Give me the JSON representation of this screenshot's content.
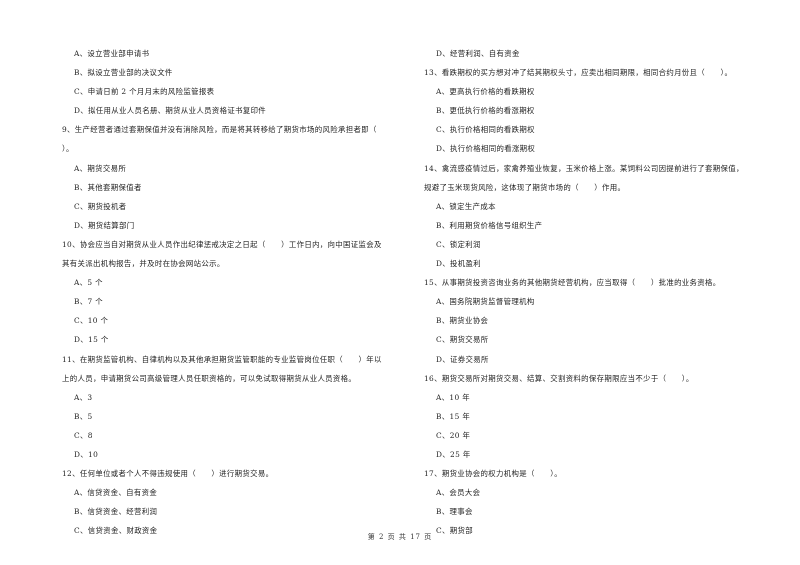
{
  "left_column": [
    {
      "type": "opt",
      "text": "A、设立营业部申请书"
    },
    {
      "type": "opt",
      "text": "B、拟设立营业部的决议文件"
    },
    {
      "type": "opt",
      "text": "C、申请日前 2 个月月末的风险监管报表"
    },
    {
      "type": "opt",
      "text": "D、拟任用从业人员名册、期货从业人员资格证书复印件"
    },
    {
      "type": "q",
      "text": "9、生产经营者通过套期保值并没有消除风险，而是将其转移给了期货市场的风险承担者即（"
    },
    {
      "type": "q",
      "text": "）。"
    },
    {
      "type": "opt",
      "text": "A、期货交易所"
    },
    {
      "type": "opt",
      "text": "B、其他套期保值者"
    },
    {
      "type": "opt",
      "text": "C、期货投机者"
    },
    {
      "type": "opt",
      "text": "D、期货结算部门"
    },
    {
      "type": "q",
      "text": "10、协会应当自对期货从业人员作出纪律惩戒决定之日起（　　）工作日内，向中国证监会及"
    },
    {
      "type": "q",
      "text": "其有关派出机构报告，并及时在协会网站公示。"
    },
    {
      "type": "opt",
      "text": "A、5 个"
    },
    {
      "type": "opt",
      "text": "B、7 个"
    },
    {
      "type": "opt",
      "text": "C、10 个"
    },
    {
      "type": "opt",
      "text": "D、15 个"
    },
    {
      "type": "q",
      "text": "11、在期货监管机构、自律机构以及其他承担期货监管职能的专业监管岗位任职（　　）年以"
    },
    {
      "type": "q",
      "text": "上的人员，申请期货公司高级管理人员任职资格的，可以免试取得期货从业人员资格。"
    },
    {
      "type": "opt",
      "text": "A、3"
    },
    {
      "type": "opt",
      "text": "B、5"
    },
    {
      "type": "opt",
      "text": "C、8"
    },
    {
      "type": "opt",
      "text": "D、10"
    },
    {
      "type": "q",
      "text": "12、任何单位或者个人不得违规使用（　　）进行期货交易。"
    },
    {
      "type": "opt",
      "text": "A、信贷资金、自有资金"
    },
    {
      "type": "opt",
      "text": "B、信贷资金、经营利润"
    },
    {
      "type": "opt",
      "text": "C、信贷资金、财政资金"
    }
  ],
  "right_column": [
    {
      "type": "opt",
      "text": "D、经营利润、自有资金"
    },
    {
      "type": "q",
      "text": "13、看跌期权的买方想对冲了结其期权头寸，应卖出相同期限，相同合约月份且（　　）。"
    },
    {
      "type": "opt",
      "text": "A、更高执行价格的看跌期权"
    },
    {
      "type": "opt",
      "text": "B、更低执行价格的看涨期权"
    },
    {
      "type": "opt",
      "text": "C、执行价格相同的看跌期权"
    },
    {
      "type": "opt",
      "text": "D、执行价格相同的看涨期权"
    },
    {
      "type": "q",
      "text": "14、禽流感疫情过后，家禽养殖业恢复，玉米价格上涨。某饲料公司因提前进行了套期保值，"
    },
    {
      "type": "q",
      "text": "规避了玉米现货风险，这体现了期货市场的（　　）作用。"
    },
    {
      "type": "opt",
      "text": "A、锁定生产成本"
    },
    {
      "type": "opt",
      "text": "B、利用期货价格信号组织生产"
    },
    {
      "type": "opt",
      "text": "C、锁定利润"
    },
    {
      "type": "opt",
      "text": "D、投机盈利"
    },
    {
      "type": "q",
      "text": "15、从事期货投资咨询业务的其他期货经营机构，应当取得（　　）批准的业务资格。"
    },
    {
      "type": "opt",
      "text": "A、国务院期货监督管理机构"
    },
    {
      "type": "opt",
      "text": "B、期货业协会"
    },
    {
      "type": "opt",
      "text": "C、期货交易所"
    },
    {
      "type": "opt",
      "text": "D、证券交易所"
    },
    {
      "type": "q",
      "text": "16、期货交易所对期货交易、结算、交割资料的保存期限应当不少于（　　）。"
    },
    {
      "type": "opt",
      "text": "A、10 年"
    },
    {
      "type": "opt",
      "text": "B、15 年"
    },
    {
      "type": "opt",
      "text": "C、20 年"
    },
    {
      "type": "opt",
      "text": "D、25 年"
    },
    {
      "type": "q",
      "text": "17、期货业协会的权力机构是（　　）。"
    },
    {
      "type": "opt",
      "text": "A、会员大会"
    },
    {
      "type": "opt",
      "text": "B、理事会"
    },
    {
      "type": "opt",
      "text": "C、期货部"
    }
  ],
  "footer": {
    "page_label": "第 2 页 共 17 页"
  }
}
